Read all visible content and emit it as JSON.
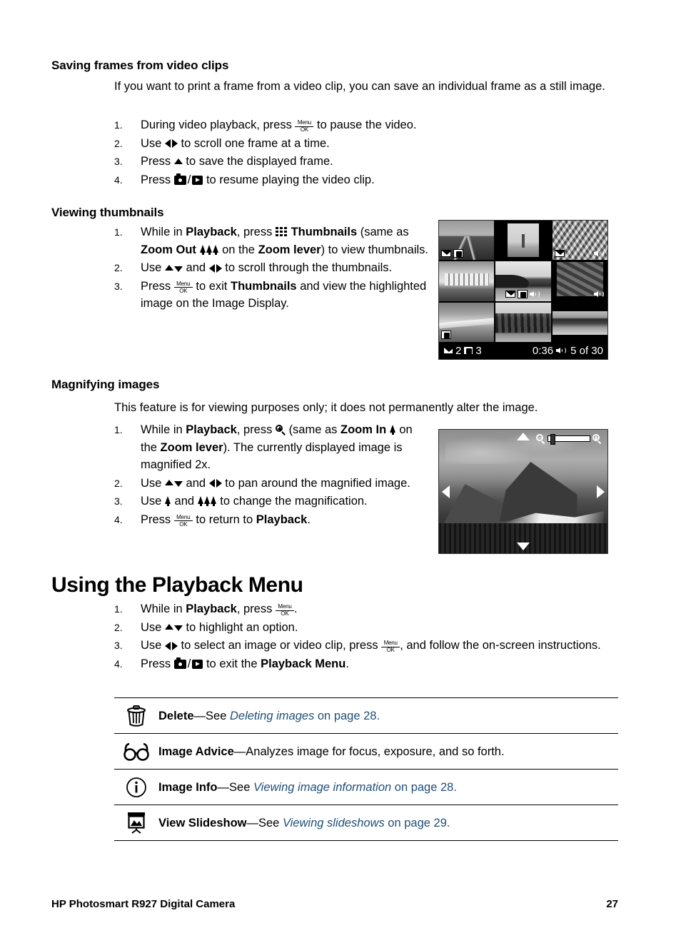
{
  "document": {
    "footer_title": "HP Photosmart R927 Digital Camera",
    "page_number": "27"
  },
  "sections": [
    {
      "id": "saving-frames",
      "heading": "Saving frames from video clips",
      "intro": "If you want to print a frame from a video clip, you can save an individual frame as a still image.",
      "steps": [
        {
          "num": "1.",
          "text_parts": [
            "During video playback, press ",
            "[menu-ok]",
            " to pause the video."
          ]
        },
        {
          "num": "2.",
          "text_parts": [
            "Use ",
            "[left-right-arrows]",
            " to scroll one frame at a time."
          ]
        },
        {
          "num": "3.",
          "text_parts": [
            "Press ",
            "[up-arrow]",
            " to save the displayed frame."
          ]
        },
        {
          "num": "4.",
          "text_parts": [
            "Press ",
            "[camera]/[playback]",
            " to resume playing the video clip."
          ]
        }
      ]
    },
    {
      "id": "viewing-thumbnails",
      "heading": "Viewing thumbnails",
      "steps": [
        {
          "num": "1.",
          "text": "While in Playback, press [grid] Thumbnails (same as Zoom Out [trees] on the Zoom lever) to view thumbnails."
        },
        {
          "num": "2.",
          "text": "Use [up-down] and [left-right] to scroll through the thumbnails."
        },
        {
          "num": "3.",
          "text": "Press [menu-ok] to exit Thumbnails and view the highlighted image on the Image Display."
        }
      ]
    },
    {
      "id": "magnifying-images",
      "heading": "Magnifying images",
      "intro": "This feature is for viewing purposes only; it does not permanently alter the image.",
      "steps": [
        {
          "num": "1.",
          "text": "While in Playback, press [magnifier] (same as Zoom In [tree] on the Zoom lever). The currently displayed image is magnified 2x."
        },
        {
          "num": "2.",
          "text": "Use [up-down] and [left-right] to pan around the magnified image."
        },
        {
          "num": "3.",
          "text": "Use [tree] and [trees] to change the magnification."
        },
        {
          "num": "4.",
          "text": "Press [menu-ok] to return to Playback."
        }
      ]
    },
    {
      "id": "playback-menu",
      "heading": "Using the Playback Menu",
      "steps": [
        {
          "num": "1.",
          "text": "While in Playback, press [menu-ok]."
        },
        {
          "num": "2.",
          "text": "Use [up-down] to highlight an option."
        },
        {
          "num": "3.",
          "text": "Use [left-right] to select an image or video clip, press [menu-ok], and follow the on-screen instructions."
        },
        {
          "num": "4.",
          "text": "Press [camera]/[playback] to exit the Playback Menu."
        }
      ]
    }
  ],
  "text": {
    "saving": {
      "heading": "Saving frames from video clips",
      "intro": "If you want to print a frame from a video clip, you can save an individual frame as a still image.",
      "s1_a": "During video playback, press",
      "s1_b": "to pause the video.",
      "s2_a": "Use",
      "s2_b": "to scroll one frame at a time.",
      "s3_a": "Press",
      "s3_b": "to save the displayed frame.",
      "s4_a": "Press",
      "s4_b": "to resume playing the video clip."
    },
    "thumbnails": {
      "heading": "Viewing thumbnails",
      "s1_a": "While in",
      "s1_playback": "Playback",
      "s1_b": ", press",
      "s1_thumbnails": "Thumbnails",
      "s1_c": "(same as",
      "s1_zoomout": "Zoom Out",
      "s1_d": "on the",
      "s1_zoomlever": "Zoom lever",
      "s1_e": ") to view thumbnails.",
      "s2_a": "Use",
      "s2_and": "and",
      "s2_b": "to scroll through the thumbnails.",
      "s3_a": "Press",
      "s3_b": "to exit",
      "s3_thumbnails": "Thumbnails",
      "s3_c": "and view the highlighted image on the Image Display."
    },
    "magnifying": {
      "heading": "Magnifying images",
      "intro": "This feature is for viewing purposes only; it does not permanently alter the image.",
      "s1_a": "While in",
      "s1_playback": "Playback",
      "s1_b": ", press",
      "s1_c": "(same as",
      "s1_zoomin": "Zoom In",
      "s1_d": "on the",
      "s1_zoomlever": "Zoom lever",
      "s1_e": "). The currently displayed image is magnified 2x.",
      "s2_a": "Use",
      "s2_and": "and",
      "s2_b": "to pan around the magnified image.",
      "s3_a": "Use",
      "s3_and": "and",
      "s3_b": "to change the magnification.",
      "s4_a": "Press",
      "s4_b": "to return to",
      "s4_playback": "Playback",
      "s4_c": "."
    },
    "playback_menu": {
      "heading": "Using the Playback Menu",
      "s1_a": "While in",
      "s1_playback": "Playback",
      "s1_b": ", press",
      "s1_c": ".",
      "s2_a": "Use",
      "s2_b": "to highlight an option.",
      "s3_a": "Use",
      "s3_b": "to select an image or video clip, press",
      "s3_c": ", and follow the on-screen instructions.",
      "s4_a": "Press",
      "s4_b": "to exit the",
      "s4_menu": "Playback Menu",
      "s4_c": "."
    },
    "numbers": {
      "n1": "1.",
      "n2": "2.",
      "n3": "3.",
      "n4": "4."
    },
    "menuok": {
      "menu": "Menu",
      "ok": "OK"
    }
  },
  "screens": {
    "thumbnail_screen": {
      "status_left_count_1": "2",
      "status_left_count_2": "3",
      "status_duration": "0:36",
      "status_index": "5 of 30"
    },
    "magnified_screen": {
      "zoom_out_icon": "magnifier-minus-icon",
      "zoom_in_icon": "magnifier-plus-icon"
    }
  },
  "menu_table": {
    "rows": [
      {
        "icon": "trash-icon",
        "label": "Delete",
        "dash": "—See ",
        "link": "Deleting images",
        "suffix": " on page 28."
      },
      {
        "icon": "glasses-icon",
        "label": "Image Advice",
        "dash": "—Analyzes image for focus, exposure, and so forth.",
        "link": "",
        "suffix": ""
      },
      {
        "icon": "info-icon",
        "label": "Image Info",
        "dash": "—See ",
        "link": "Viewing image information",
        "suffix": " on page 28."
      },
      {
        "icon": "slideshow-icon",
        "label": "View Slideshow",
        "dash": "—See ",
        "link": "Viewing slideshows",
        "suffix": " on page 29."
      }
    ]
  },
  "colors": {
    "link": "#1F4E79",
    "text": "#000000",
    "background": "#FFFFFF"
  }
}
